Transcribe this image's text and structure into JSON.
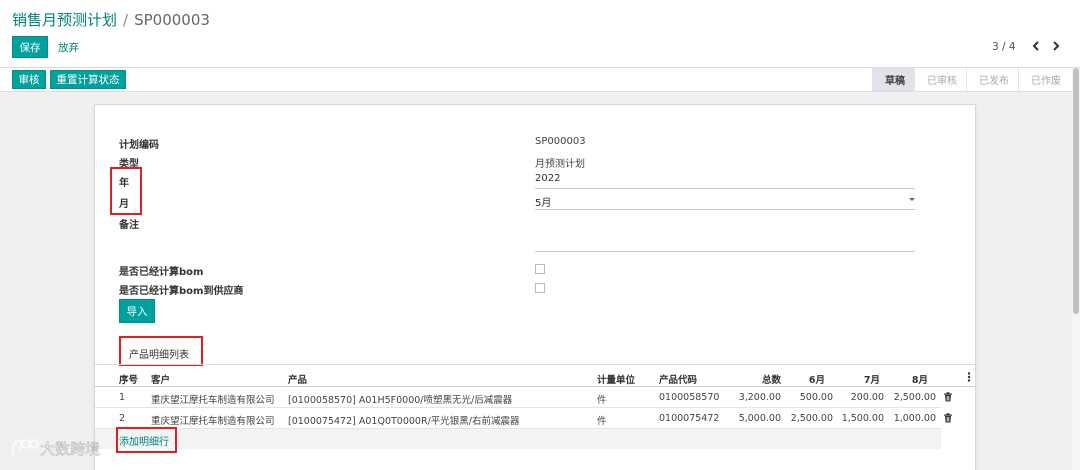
{
  "breadcrumb": {
    "parent": "销售月预测计划",
    "separator": "/",
    "current": "SP000003"
  },
  "toolbar": {
    "save_label": "保存",
    "discard_label": "放弃"
  },
  "pager": {
    "value": "3 / 4",
    "prev_icon": "chevron-left-icon",
    "next_icon": "chevron-right-icon"
  },
  "header_buttons": {
    "approve": "审核",
    "recalc": "重置计算状态"
  },
  "stages": [
    {
      "label": "草稿",
      "active": true
    },
    {
      "label": "已审核",
      "active": false
    },
    {
      "label": "已发布",
      "active": false
    },
    {
      "label": "已作废",
      "active": false
    }
  ],
  "form": {
    "plan_code_label": "计划编码",
    "plan_code": "SP000003",
    "type_label": "类型",
    "type": "月预测计划",
    "year_label": "年",
    "year": "2022",
    "month_label": "月",
    "month": "5月",
    "remark_label": "备注",
    "remark": "",
    "bom_label": "是否已经计算bom",
    "bom_checked": false,
    "bom_supplier_label": "是否已经计算bom到供应商",
    "bom_supplier_checked": false,
    "import_label": "导入"
  },
  "tab": {
    "label": "产品明细列表"
  },
  "table": {
    "headers": [
      "序号",
      "客户",
      "产品",
      "计量单位",
      "产品代码",
      "总数",
      "6月",
      "7月",
      "8月"
    ],
    "rows": [
      {
        "seq": "1",
        "customer": "重庆望江摩托车制造有限公司",
        "product": "[0100058570] A01H5F0000/喷塑黑无光/后减震器",
        "unit": "件",
        "code": "0100058570",
        "total": "3,200.00",
        "m6": "500.00",
        "m7": "200.00",
        "m8": "2,500.00"
      },
      {
        "seq": "2",
        "customer": "重庆望江摩托车制造有限公司",
        "product": "[0100075472] A01Q0T0000R/平光银黑/右前减震器",
        "unit": "件",
        "code": "0100075472",
        "total": "5,000.00",
        "m6": "2,500.00",
        "m7": "1,500.00",
        "m8": "1,000.00"
      }
    ],
    "add_line": "添加明细行"
  },
  "watermark": {
    "text": "大数跨境"
  },
  "colors": {
    "primary": "#00a09d",
    "link": "#00827c",
    "highlight_box": "#e02020"
  }
}
